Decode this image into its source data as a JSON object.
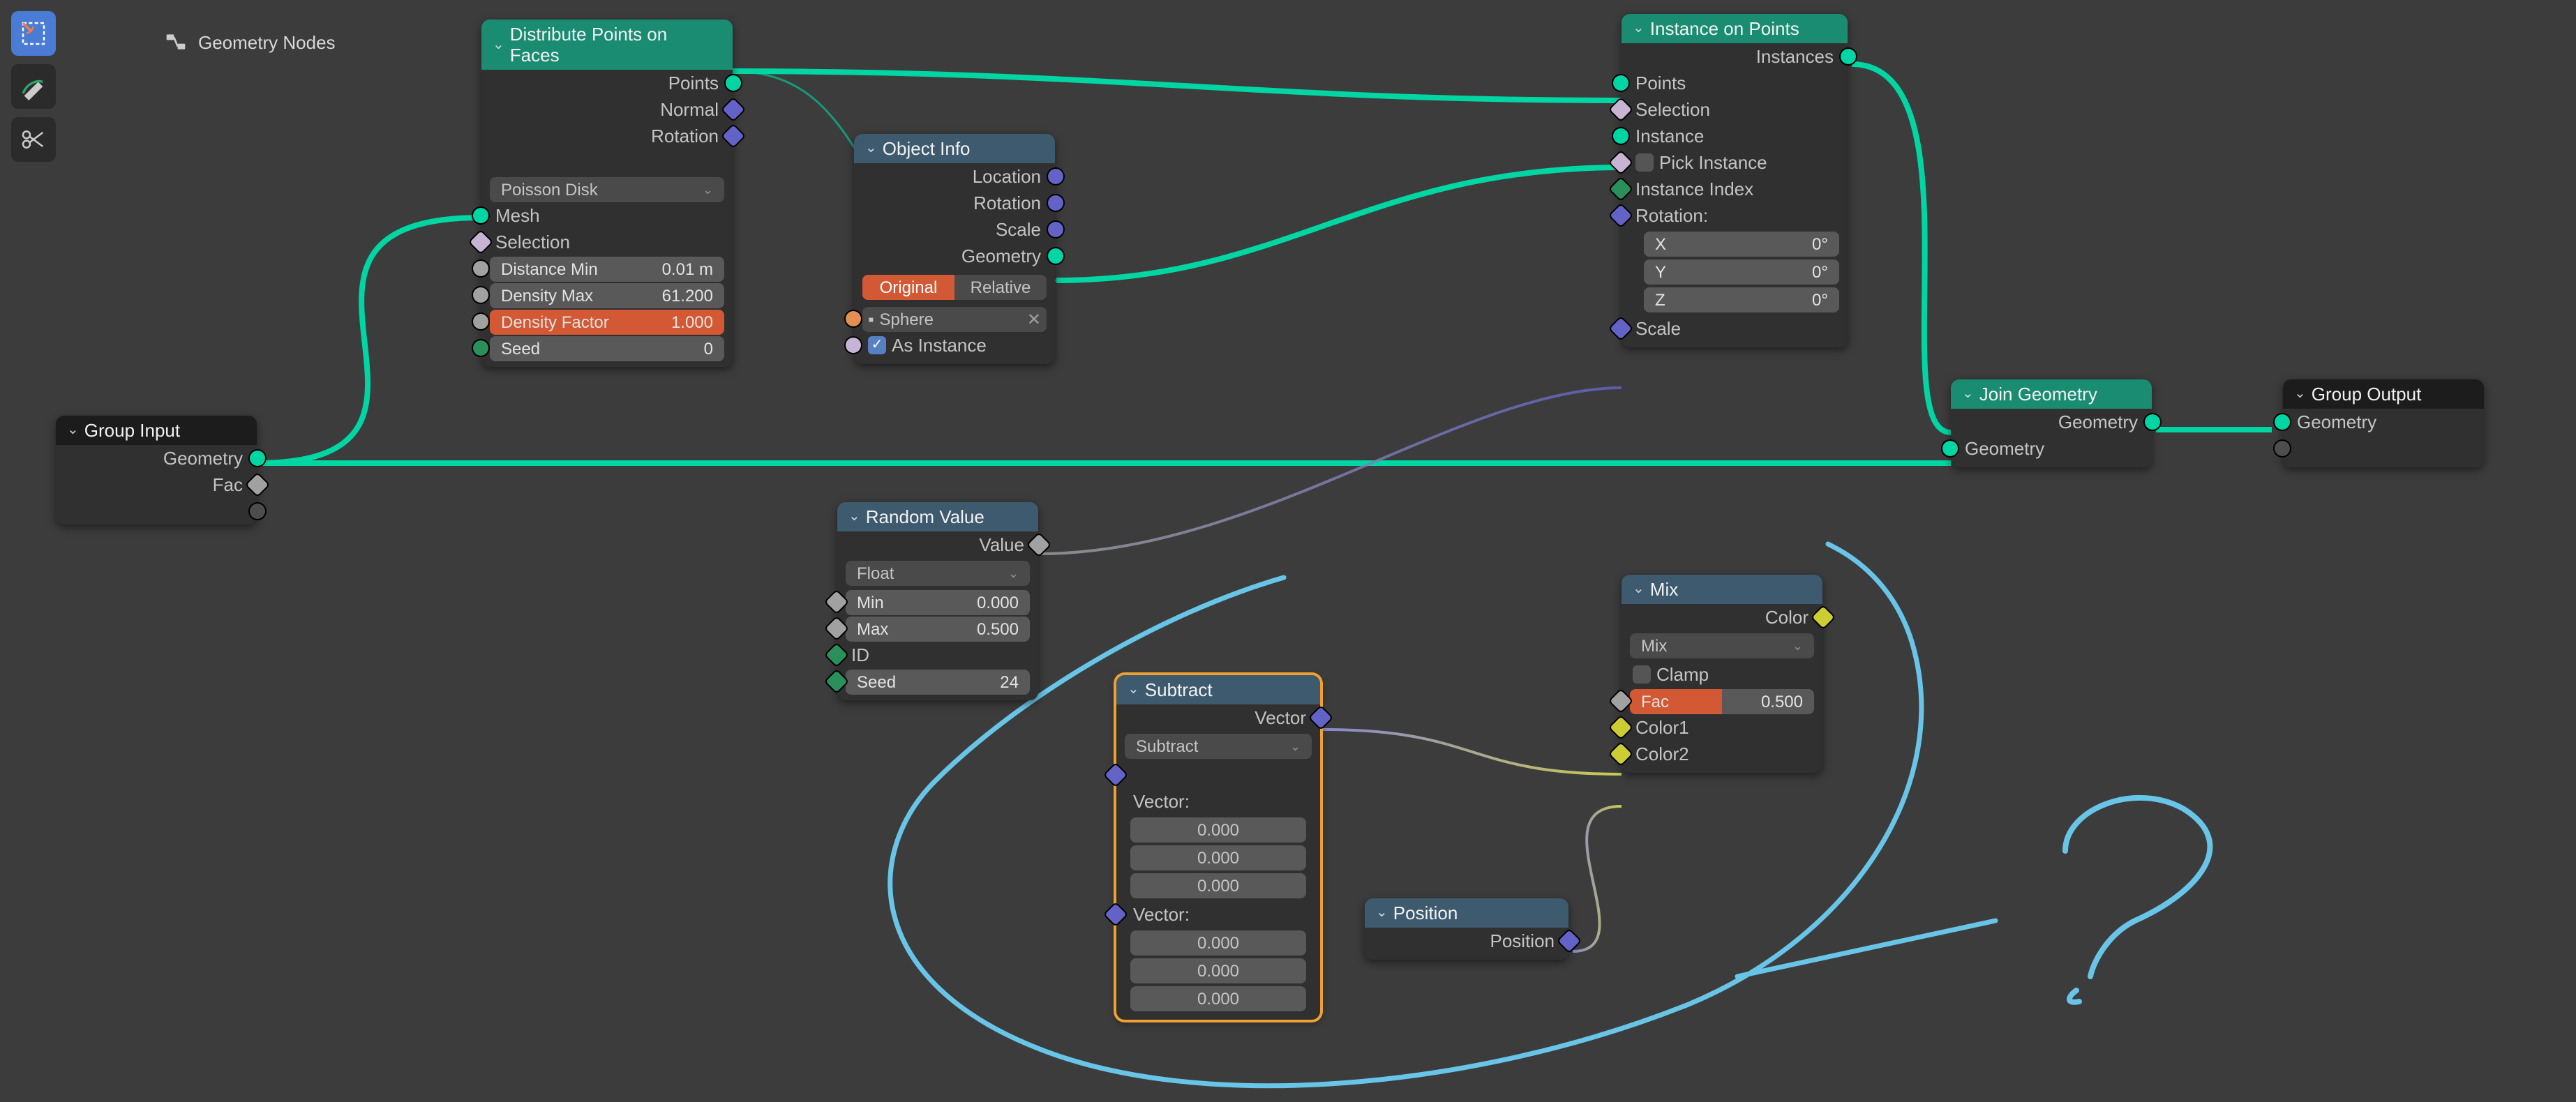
{
  "header": {
    "title": "Geometry Nodes"
  },
  "toolbar": {
    "select_box": "Select Box",
    "annotate": "Annotate",
    "links_cut": "Links Cut"
  },
  "nodes": {
    "group_input": {
      "title": "Group Input",
      "outputs": {
        "geometry": "Geometry",
        "fac": "Fac"
      }
    },
    "distribute": {
      "title": "Distribute Points on Faces",
      "outputs": {
        "points": "Points",
        "normal": "Normal",
        "rotation": "Rotation"
      },
      "method": "Poisson Disk",
      "inputs": {
        "mesh": "Mesh",
        "selection": "Selection"
      },
      "fields": {
        "distance_min": {
          "label": "Distance Min",
          "value": "0.01 m"
        },
        "density_max": {
          "label": "Density Max",
          "value": "61.200"
        },
        "density_factor": {
          "label": "Density Factor",
          "value": "1.000"
        },
        "seed": {
          "label": "Seed",
          "value": "0"
        }
      }
    },
    "object_info": {
      "title": "Object Info",
      "outputs": {
        "location": "Location",
        "rotation": "Rotation",
        "scale": "Scale",
        "geometry": "Geometry"
      },
      "mode": {
        "original": "Original",
        "relative": "Relative"
      },
      "object": "Sphere",
      "as_instance": "As Instance"
    },
    "instance_on_points": {
      "title": "Instance on Points",
      "outputs": {
        "instances": "Instances"
      },
      "inputs": {
        "points": "Points",
        "selection": "Selection",
        "instance": "Instance",
        "pick_instance": "Pick Instance",
        "instance_index": "Instance Index",
        "rotation_label": "Rotation:",
        "rot_x": {
          "label": "X",
          "value": "0°"
        },
        "rot_y": {
          "label": "Y",
          "value": "0°"
        },
        "rot_z": {
          "label": "Z",
          "value": "0°"
        },
        "scale": "Scale"
      }
    },
    "join_geometry": {
      "title": "Join Geometry",
      "outputs": {
        "geometry": "Geometry"
      },
      "inputs": {
        "geometry": "Geometry"
      }
    },
    "group_output": {
      "title": "Group Output",
      "inputs": {
        "geometry": "Geometry"
      }
    },
    "random_value": {
      "title": "Random Value",
      "outputs": {
        "value": "Value"
      },
      "dtype": "Float",
      "fields": {
        "min": {
          "label": "Min",
          "value": "0.000"
        },
        "max": {
          "label": "Max",
          "value": "0.500"
        },
        "id": "ID",
        "seed": {
          "label": "Seed",
          "value": "24"
        }
      }
    },
    "subtract": {
      "title": "Subtract",
      "outputs": {
        "vector": "Vector"
      },
      "op": "Subtract",
      "vec_a_label": "Vector:",
      "vec_a": [
        "0.000",
        "0.000",
        "0.000"
      ],
      "vec_b_label": "Vector:",
      "vec_b": [
        "0.000",
        "0.000",
        "0.000"
      ]
    },
    "mix": {
      "title": "Mix",
      "outputs": {
        "color": "Color"
      },
      "blend": "Mix",
      "clamp": "Clamp",
      "fac": {
        "label": "Fac",
        "value": "0.500"
      },
      "color1": "Color1",
      "color2": "Color2"
    },
    "position": {
      "title": "Position",
      "outputs": {
        "position": "Position"
      }
    }
  }
}
